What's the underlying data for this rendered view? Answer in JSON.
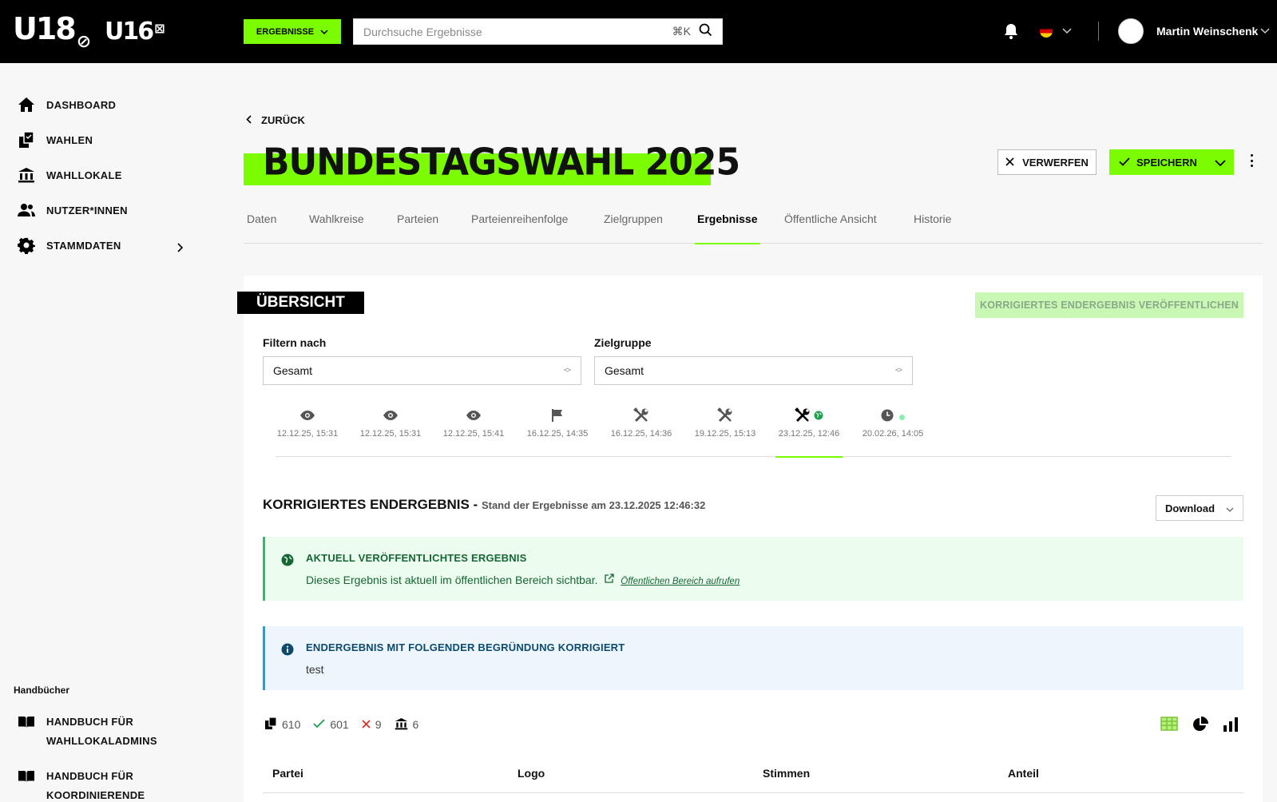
{
  "topbar": {
    "logo_primary": "U18",
    "logo_secondary": "U16",
    "mode_label": "ERGEBNISSE",
    "search_placeholder": "Durchsuche Ergebnisse",
    "search_shortcut": "⌘K",
    "user_name": "Martin Weinschenk"
  },
  "sidebar": {
    "items": [
      {
        "label": "DASHBOARD",
        "icon": "home-icon"
      },
      {
        "label": "WAHLEN",
        "icon": "ballot-icon"
      },
      {
        "label": "WAHLLOKALE",
        "icon": "building-icon"
      },
      {
        "label": "NUTZER*INNEN",
        "icon": "users-icon"
      },
      {
        "label": "STAMMDATEN",
        "icon": "gear-icon"
      }
    ],
    "handbooks_title": "Handbücher",
    "handbooks": [
      {
        "line1": "HANDBUCH FÜR",
        "line2": "WAHLLOKALADMINS"
      },
      {
        "line1": "HANDBUCH FÜR",
        "line2": "KOORDINIERENDE"
      }
    ]
  },
  "header": {
    "back_label": "ZURÜCK",
    "title": "BUNDESTAGSWAHL 2025",
    "discard_label": "VERWERFEN",
    "save_label": "SPEICHERN"
  },
  "tabs": [
    "Daten",
    "Wahlkreise",
    "Parteien",
    "Parteienreihenfolge",
    "Zielgruppen",
    "Ergebnisse",
    "Öffentliche Ansicht",
    "Historie"
  ],
  "active_tab": "Ergebnisse",
  "overview": {
    "title": "ÜBERSICHT",
    "publish_label": "KORRIGIERTES ENDERGEBNIS VERÖFFENTLICHEN",
    "filter_label": "Filtern nach",
    "filter_value": "Gesamt",
    "group_label": "Zielgruppe",
    "group_value": "Gesamt"
  },
  "versions": [
    {
      "icon": "eye-icon",
      "date": "12.12.25, 15:31"
    },
    {
      "icon": "eye-icon",
      "date": "12.12.25, 15:31"
    },
    {
      "icon": "eye-icon",
      "date": "12.12.25, 15:41"
    },
    {
      "icon": "flag-icon",
      "date": "16.12.25, 14:35"
    },
    {
      "icon": "tools-icon",
      "date": "16.12.25, 14:36"
    },
    {
      "icon": "tools-icon",
      "date": "19.12.25, 15:13"
    },
    {
      "icon": "tools-icon",
      "date": "23.12.25, 12:46",
      "badge": "globe-icon",
      "active": true
    },
    {
      "icon": "clock-icon",
      "date": "20.02.26, 14:05",
      "badge": "dot"
    }
  ],
  "result": {
    "title": "KORRIGIERTES ENDERGEBNIS -",
    "subtitle": "Stand der Ergebnisse am 23.12.2025 12:46:32",
    "download_label": "Download"
  },
  "alerts": {
    "published_title": "AKTUELL VERÖFFENTLICHTES ERGEBNIS",
    "published_text": "Dieses Ergebnis ist aktuell im öffentlichen Bereich sichtbar.",
    "published_link": "Öffentlichen Bereich aufrufen",
    "corrected_title": "ENDERGEBNIS MIT FOLGENDER BEGRÜNDUNG KORRIGIERT",
    "corrected_text": "test"
  },
  "stats": {
    "ballots": "610",
    "valid": "601",
    "invalid": "9",
    "locations": "6"
  },
  "table": {
    "headers": [
      "Partei",
      "Logo",
      "Stimmen",
      "Anteil"
    ]
  },
  "colors": {
    "accent": "#7cfc00",
    "success": "#22c55e",
    "info": "#0ea5e9"
  }
}
